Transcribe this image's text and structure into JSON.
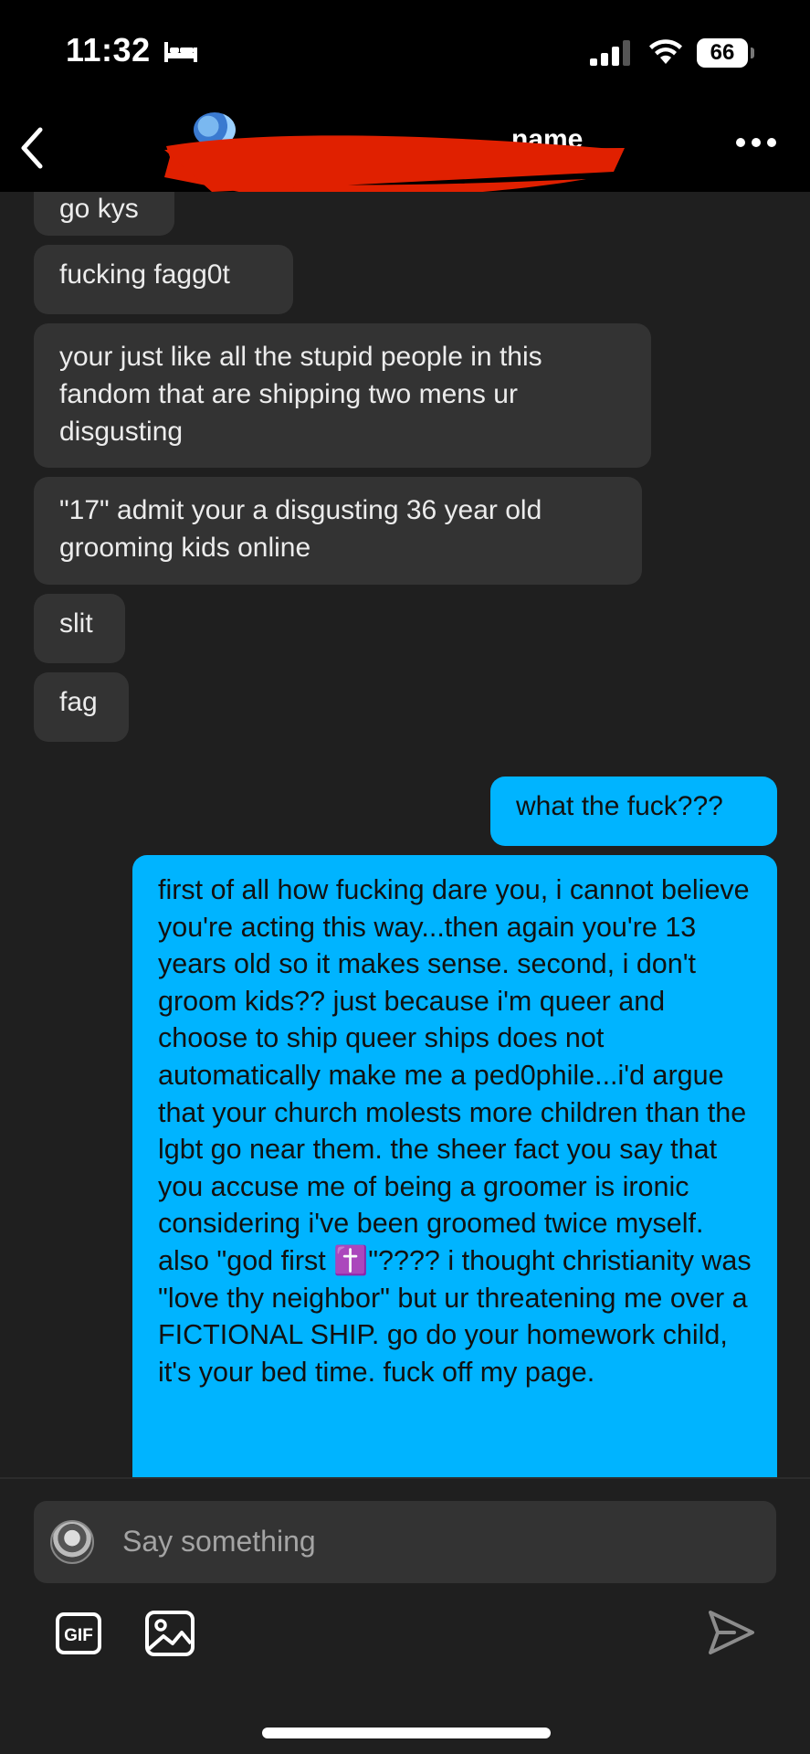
{
  "status_bar": {
    "time": "11:32",
    "battery": "66",
    "icons": [
      "bed-icon",
      "signal-icon",
      "wifi-icon",
      "battery-icon"
    ]
  },
  "header": {
    "name_visible_fragment": "name",
    "back_icon": "chevron-left-icon",
    "more_icon": "more-horizontal-icon",
    "redaction_color": "#e02000"
  },
  "messages": [
    {
      "direction": "incoming",
      "text": "go kys"
    },
    {
      "direction": "incoming",
      "text": "fucking fagg0t"
    },
    {
      "direction": "incoming",
      "text": "your just like all the stupid people in this fandom that are shipping two mens ur disgusting"
    },
    {
      "direction": "incoming",
      "text": "\"17\" admit your a disgusting 36 year old grooming kids online"
    },
    {
      "direction": "incoming",
      "text": "slit"
    },
    {
      "direction": "incoming",
      "text": "fag"
    },
    {
      "direction": "outgoing",
      "text": "what the fuck???"
    },
    {
      "direction": "outgoing",
      "text": "first of all how fucking dare you, i cannot believe you're acting this way...then again you're 13 years old so it makes sense. second, i don't groom kids?? just because i'm queer and choose to ship queer ships does not automatically make me a ped0phile...i'd argue that your church molests more children than the lgbt go near them. the sheer fact you say that you accuse me of being a groomer is ironic considering i've been groomed twice myself. also \"god first ✝️\"???? i thought christianity was \"love thy neighbor\" but ur threatening me over a FICTIONAL SHIP. go do your homework child, it's your bed time. fuck off my page."
    }
  ],
  "composer": {
    "placeholder": "Say something",
    "gif_label": "GIF",
    "icons": [
      "gif-icon",
      "image-icon",
      "send-icon"
    ]
  },
  "colors": {
    "incoming_bubble": "#333333",
    "outgoing_bubble": "#00b4ff",
    "background": "#1f1f1f",
    "header": "#000000"
  }
}
